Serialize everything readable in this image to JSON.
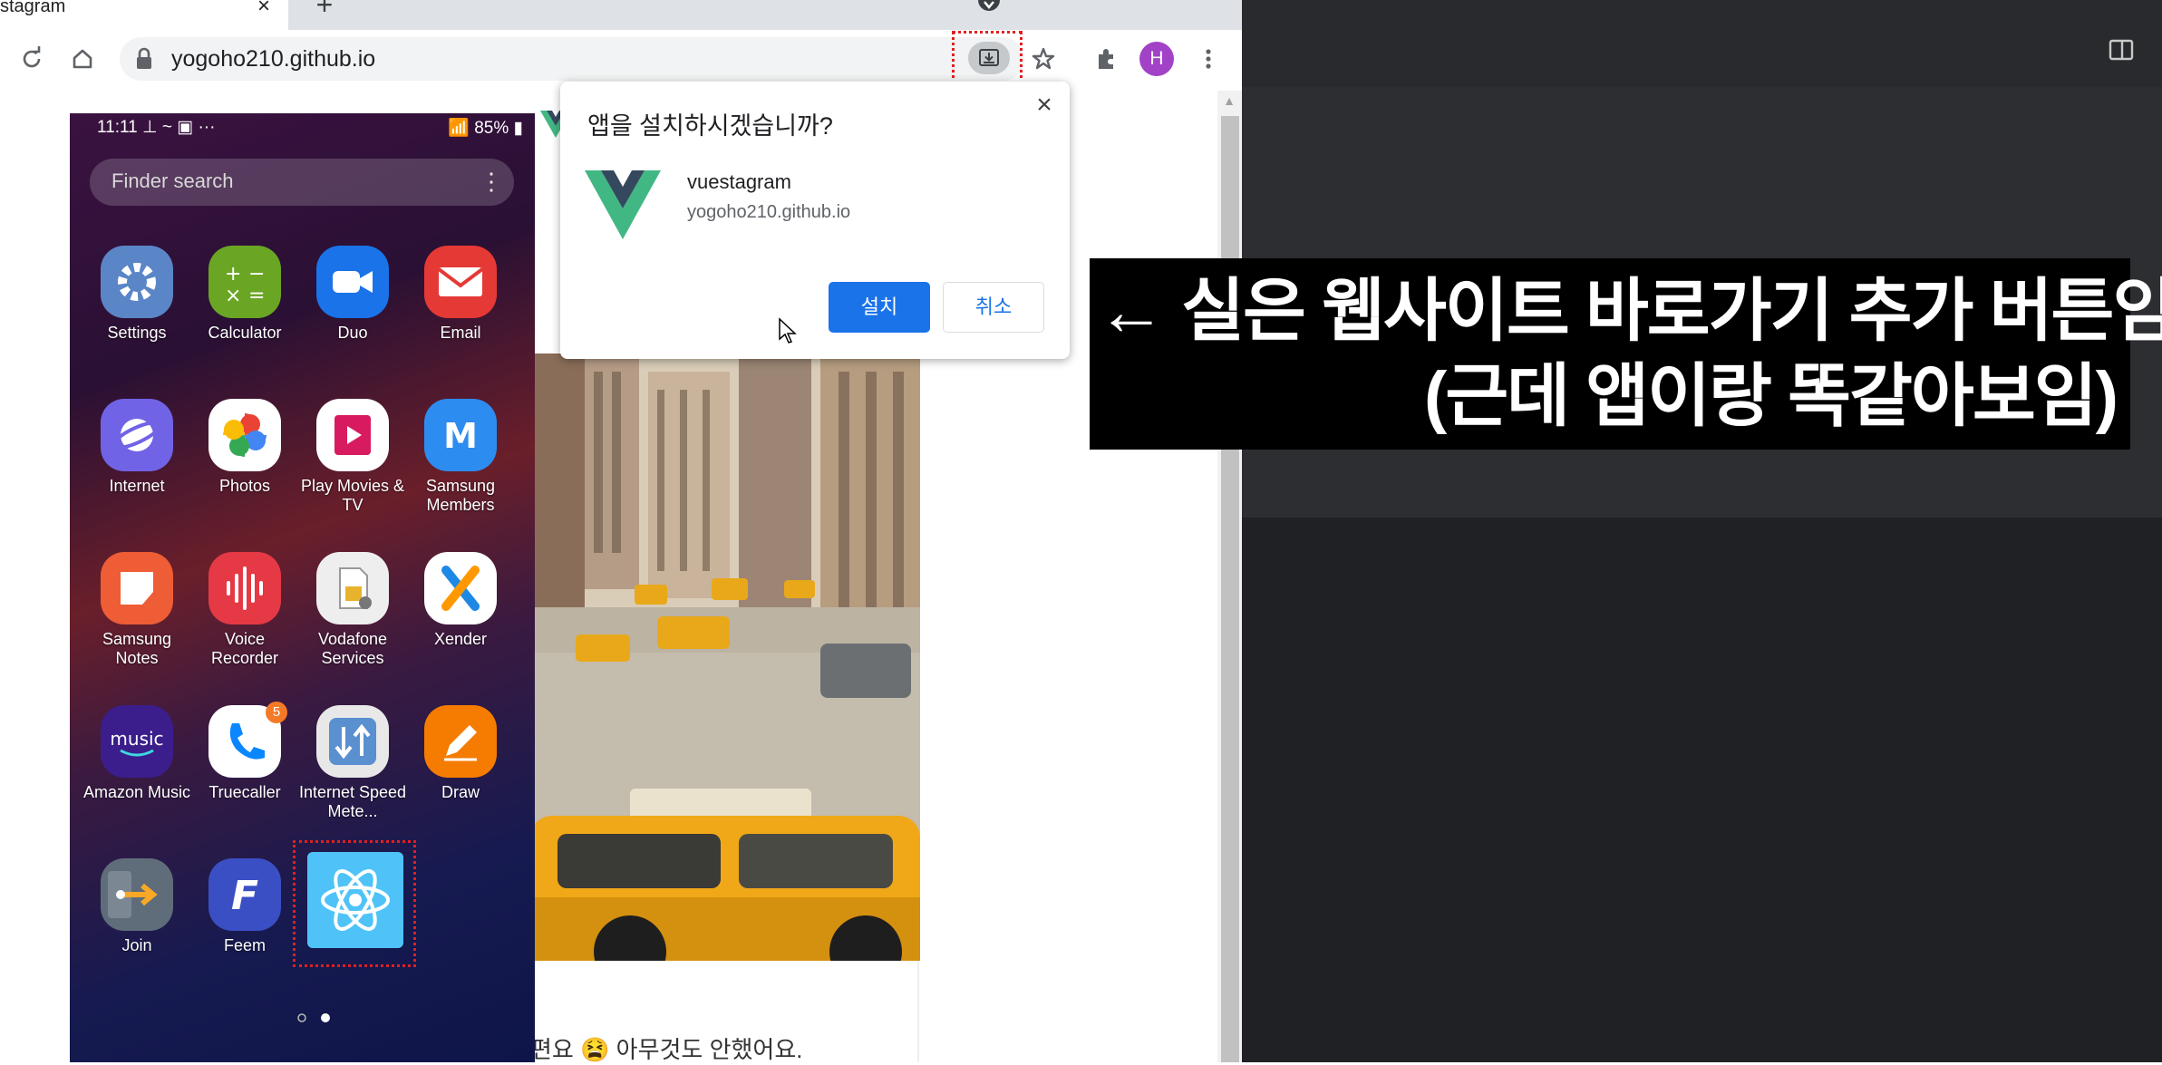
{
  "browser": {
    "tab_title": "stagram",
    "tab_close": "×",
    "new_tab": "+",
    "url": "yogoho210.github.io",
    "avatar_letter": "H"
  },
  "dialog": {
    "title": "앱을 설치하시겠습니까?",
    "close": "×",
    "app_name": "vuestagram",
    "app_origin": "yogoho210.github.io",
    "install_label": "설치",
    "cancel_label": "취소"
  },
  "annotation": {
    "line1": "← 실은 웹사이트 바로가기 추가 버튼임",
    "line2": "(근데 앱이랑 똑같아보임)"
  },
  "page": {
    "caption": "편요 😫 아무것도 안했어요."
  },
  "phone": {
    "time": "11:11",
    "status_icons": "⊥ ~ ▣ ···",
    "battery": "85%",
    "search_placeholder": "Finder search",
    "search_menu": "⋮",
    "apps": [
      {
        "label": "Settings",
        "icon": "gear-icon",
        "color": "#4c7cc6"
      },
      {
        "label": "Calculator",
        "icon": "calculator-icon",
        "color": "#6aa624"
      },
      {
        "label": "Duo",
        "icon": "video-camera-icon",
        "color": "#1a73e8"
      },
      {
        "label": "Email",
        "icon": "mail-icon",
        "color": "#e53935"
      },
      {
        "label": "Internet",
        "icon": "planet-icon",
        "color": "#6b5de0"
      },
      {
        "label": "Photos",
        "icon": "pinwheel-icon",
        "color": "#ffffff"
      },
      {
        "label": "Play Movies & TV",
        "icon": "play-film-icon",
        "color": "#ffffff"
      },
      {
        "label": "Samsung Members",
        "icon": "members-m-icon",
        "color": "#2d8cf0"
      },
      {
        "label": "Samsung Notes",
        "icon": "notes-icon",
        "color": "#ee5d35"
      },
      {
        "label": "Voice Recorder",
        "icon": "waveform-icon",
        "color": "#e53945"
      },
      {
        "label": "Vodafone Services",
        "icon": "sim-card-icon",
        "color": "#eeeeee"
      },
      {
        "label": "Xender",
        "icon": "xender-x-icon",
        "color": "#ffffff"
      },
      {
        "label": "Amazon Music",
        "icon": "amazon-music-icon",
        "color": "#3b1e8c"
      },
      {
        "label": "Truecaller",
        "icon": "phone-handset-icon",
        "color": "#ffffff"
      },
      {
        "label": "Internet Speed Mete...",
        "icon": "speed-arrows-icon",
        "color": "#5a8fd0"
      },
      {
        "label": "Draw",
        "icon": "pencil-icon",
        "color": "#f57c00"
      },
      {
        "label": "Join",
        "icon": "join-arrow-icon",
        "color": "#5f6d7a"
      },
      {
        "label": "Feem",
        "icon": "feem-f-icon",
        "color": "#3b4fc4"
      },
      {
        "label": "",
        "icon": "react-atom-icon",
        "color": "#4fc3f7"
      }
    ],
    "truecaller_badge": "5"
  },
  "colors": {
    "accent_blue": "#1a73e8",
    "highlight_red": "#e02020",
    "dark_panel": "#202124"
  }
}
